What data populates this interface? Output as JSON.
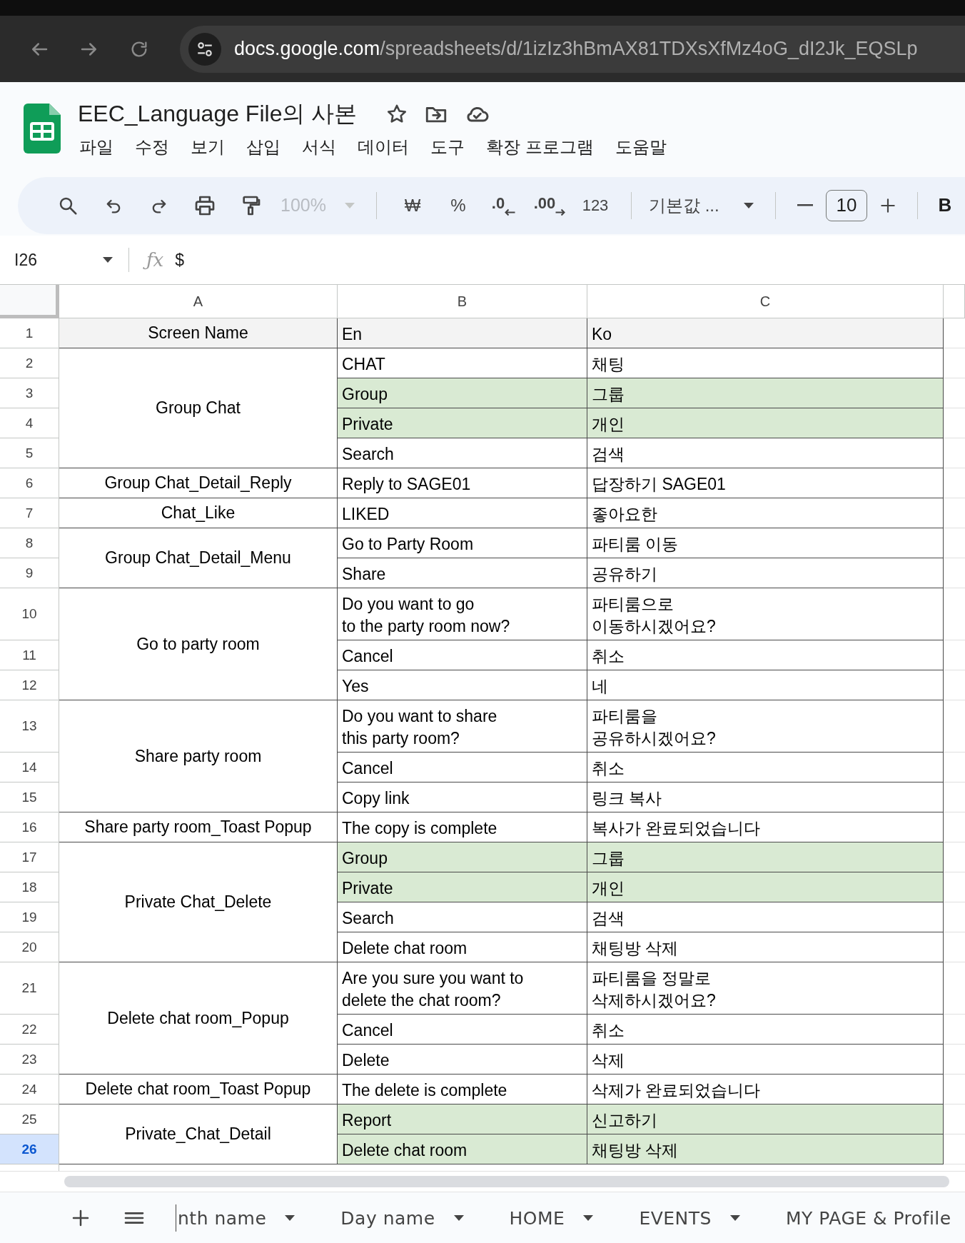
{
  "browser": {
    "url_domain": "docs.google.com",
    "url_path": "/spreadsheets/d/1izIz3hBmAX81TDXsXfMz4oG_dI2Jk_EQSLp"
  },
  "document": {
    "title": "EEC_Language File의 사본",
    "menu": [
      "파일",
      "수정",
      "보기",
      "삽입",
      "서식",
      "데이터",
      "도구",
      "확장 프로그램",
      "도움말"
    ]
  },
  "toolbar": {
    "zoom": {
      "label": "100%",
      "disabled": true
    },
    "currency": "₩",
    "percent": "%",
    "decrease_decimal": ".0",
    "increase_decimal": ".00",
    "number_format": "123",
    "font": "기본값 ...",
    "font_size": "10",
    "bold": "B"
  },
  "formula_bar": {
    "cell_ref": "I26",
    "function_label": "ƒx",
    "formula": "$"
  },
  "columns": [
    "A",
    "B",
    "C"
  ],
  "header_row": {
    "number": "1",
    "cells": [
      "Screen Name",
      "En",
      "Ko"
    ]
  },
  "groups": [
    {
      "screen_name": "Group Chat",
      "rows": [
        {
          "number": "2",
          "en": "CHAT",
          "ko": "채팅",
          "highlighted": false,
          "selected": false
        },
        {
          "number": "3",
          "en": "Group",
          "ko": "그룹",
          "highlighted": true,
          "selected": false
        },
        {
          "number": "4",
          "en": "Private",
          "ko": "개인",
          "highlighted": true,
          "selected": false
        },
        {
          "number": "5",
          "en": "Search",
          "ko": "검색",
          "highlighted": false,
          "selected": false
        }
      ]
    },
    {
      "screen_name": "Group Chat_Detail_Reply",
      "rows": [
        {
          "number": "6",
          "en": "Reply to SAGE01",
          "ko": "답장하기 SAGE01",
          "highlighted": false,
          "selected": false
        }
      ]
    },
    {
      "screen_name": "Chat_Like",
      "rows": [
        {
          "number": "7",
          "en": "LIKED",
          "ko": "좋아요한",
          "highlighted": false,
          "selected": false
        }
      ]
    },
    {
      "screen_name": "Group Chat_Detail_Menu",
      "rows": [
        {
          "number": "8",
          "en": "Go to Party Room",
          "ko": "파티룸 이동",
          "highlighted": false,
          "selected": false
        },
        {
          "number": "9",
          "en": "Share",
          "ko": "공유하기",
          "highlighted": false,
          "selected": false
        }
      ]
    },
    {
      "screen_name": "Go to party room",
      "rows": [
        {
          "number": "10",
          "en": "Do you want to go\nto the party room now?",
          "ko": "파티룸으로\n이동하시겠어요?",
          "highlighted": false,
          "selected": false
        },
        {
          "number": "11",
          "en": "Cancel",
          "ko": "취소",
          "highlighted": false,
          "selected": false
        },
        {
          "number": "12",
          "en": "Yes",
          "ko": "네",
          "highlighted": false,
          "selected": false
        }
      ]
    },
    {
      "screen_name": "Share party room",
      "rows": [
        {
          "number": "13",
          "en": "Do you want to share\nthis party room?",
          "ko": "파티룸을\n공유하시겠어요?",
          "highlighted": false,
          "selected": false
        },
        {
          "number": "14",
          "en": "Cancel",
          "ko": "취소",
          "highlighted": false,
          "selected": false
        },
        {
          "number": "15",
          "en": "Copy link",
          "ko": "링크 복사",
          "highlighted": false,
          "selected": false
        }
      ]
    },
    {
      "screen_name": "Share party room_Toast Popup",
      "rows": [
        {
          "number": "16",
          "en": "The copy is complete",
          "ko": "복사가 완료되었습니다",
          "highlighted": false,
          "selected": false
        }
      ]
    },
    {
      "screen_name": "Private Chat_Delete",
      "rows": [
        {
          "number": "17",
          "en": "Group",
          "ko": "그룹",
          "highlighted": true,
          "selected": false
        },
        {
          "number": "18",
          "en": "Private",
          "ko": "개인",
          "highlighted": true,
          "selected": false
        },
        {
          "number": "19",
          "en": "Search",
          "ko": "검색",
          "highlighted": false,
          "selected": false
        },
        {
          "number": "20",
          "en": "Delete chat room",
          "ko": "채팅방 삭제",
          "highlighted": false,
          "selected": false
        }
      ]
    },
    {
      "screen_name": "Delete chat room_Popup",
      "rows": [
        {
          "number": "21",
          "en": "Are you sure you want to\ndelete the chat room?",
          "ko": "파티룸을 정말로\n삭제하시겠어요?",
          "highlighted": false,
          "selected": false
        },
        {
          "number": "22",
          "en": "Cancel",
          "ko": "취소",
          "highlighted": false,
          "selected": false
        },
        {
          "number": "23",
          "en": "Delete",
          "ko": "삭제",
          "highlighted": false,
          "selected": false
        }
      ]
    },
    {
      "screen_name": "Delete chat room_Toast Popup",
      "rows": [
        {
          "number": "24",
          "en": "The delete is complete",
          "ko": "삭제가 완료되었습니다",
          "highlighted": false,
          "selected": false
        }
      ]
    },
    {
      "screen_name": "Private_Chat_Detail",
      "rows": [
        {
          "number": "25",
          "en": "Report",
          "ko": "신고하기",
          "highlighted": true,
          "selected": false
        },
        {
          "number": "26",
          "en": "Delete chat room",
          "ko": "채팅방 삭제",
          "highlighted": true,
          "selected": true
        }
      ]
    }
  ],
  "sheet_tabs": [
    "nth name",
    "Day name",
    "HOME",
    "EVENTS",
    "MY PAGE & Profile"
  ]
}
